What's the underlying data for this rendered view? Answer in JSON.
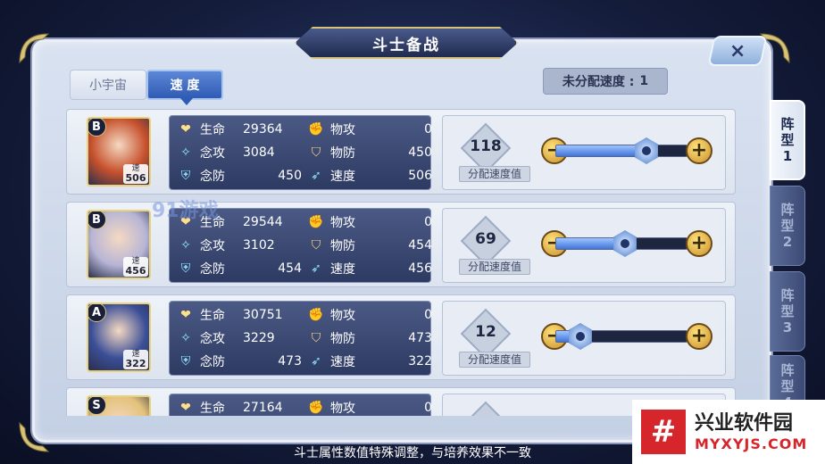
{
  "title": "斗士备战",
  "close_label": "×",
  "tabs": [
    {
      "label": "小宇宙",
      "active": false
    },
    {
      "label": "速 度",
      "active": true
    }
  ],
  "unallocated": {
    "label": "未分配速度 :",
    "value": "1"
  },
  "formations": [
    {
      "label": "阵\n型\n1",
      "active": true
    },
    {
      "label": "阵\n型\n2",
      "active": false
    },
    {
      "label": "阵\n型\n3",
      "active": false
    },
    {
      "label": "阵\n型\n4",
      "active": false
    }
  ],
  "fighters": [
    {
      "rank": "B",
      "speed_badge_label": "速",
      "speed_badge_value": "506",
      "portrait_color": "#c6502c",
      "stats": {
        "hp_label": "生命",
        "hp": "29364",
        "matk_label": "念攻",
        "matk": "3084",
        "mdef_label": "念防",
        "mdef": "450",
        "patk_label": "物攻",
        "patk": "0",
        "pdef_label": "物防",
        "pdef": "450",
        "spd_label": "速度",
        "spd": "506"
      },
      "allocated": "118",
      "allocated_label": "分配速度值",
      "fill_fraction": 0.68
    },
    {
      "rank": "B",
      "speed_badge_label": "速",
      "speed_badge_value": "456",
      "portrait_color": "#b7b5d6",
      "stats": {
        "hp_label": "生命",
        "hp": "29544",
        "matk_label": "念攻",
        "matk": "3102",
        "mdef_label": "念防",
        "mdef": "454",
        "patk_label": "物攻",
        "patk": "0",
        "pdef_label": "物防",
        "pdef": "454",
        "spd_label": "速度",
        "spd": "456"
      },
      "allocated": "69",
      "allocated_label": "分配速度值",
      "fill_fraction": 0.52
    },
    {
      "rank": "A",
      "speed_badge_label": "速",
      "speed_badge_value": "322",
      "portrait_color": "#3b4f97",
      "stats": {
        "hp_label": "生命",
        "hp": "30751",
        "matk_label": "念攻",
        "matk": "3229",
        "mdef_label": "念防",
        "mdef": "473",
        "patk_label": "物攻",
        "patk": "0",
        "pdef_label": "物防",
        "pdef": "473",
        "spd_label": "速度",
        "spd": "322"
      },
      "allocated": "12",
      "allocated_label": "分配速度值",
      "fill_fraction": 0.18
    },
    {
      "rank": "S",
      "speed_badge_label": "",
      "speed_badge_value": "",
      "portrait_color": "#e3c27a",
      "stats": {
        "hp_label": "生命",
        "hp": "27164",
        "matk_label": "",
        "matk": "",
        "mdef_label": "",
        "mdef": "",
        "patk_label": "物攻",
        "patk": "0",
        "pdef_label": "",
        "pdef": "",
        "spd_label": "",
        "spd": ""
      },
      "allocated": "",
      "allocated_label": "",
      "fill_fraction": 0.0
    }
  ],
  "footer_note": "斗士属性数值特殊调整，与培养效果不一致",
  "watermark": "91游戏",
  "brand": {
    "name": "兴业软件园",
    "url": "MYXYJS.COM",
    "logo": "#"
  },
  "colors": {
    "accent": "#2f5bb4",
    "gold": "#d6c27a",
    "panel": "#d9e2f1"
  }
}
